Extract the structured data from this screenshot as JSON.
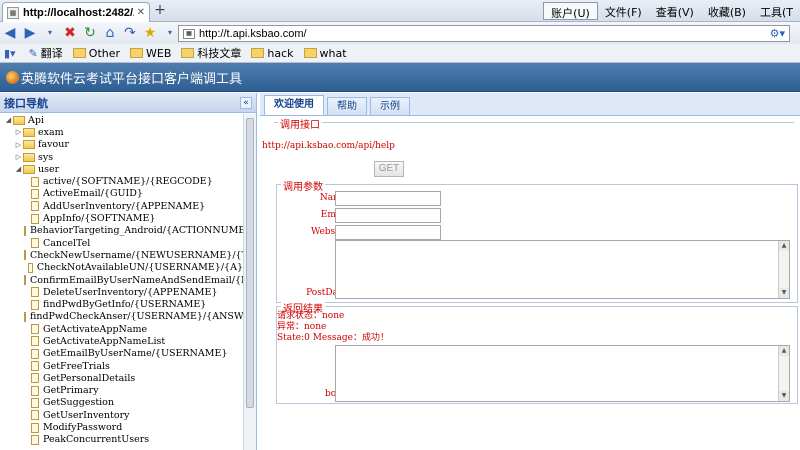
{
  "browser": {
    "tab_title": "http://localhost:2482/A...",
    "menus": [
      "账户(U)",
      "文件(F)",
      "查看(V)",
      "收藏(B)",
      "工具(T"
    ],
    "url": "http://t.api.ksbao.com/",
    "bookmarks": [
      "翻译",
      "Other",
      "WEB",
      "科技文章",
      "hack",
      "what"
    ]
  },
  "app": {
    "title": "英腾软件云考试平台接口客户端调工具"
  },
  "sidebar": {
    "title": "接口导航",
    "tree": [
      {
        "label": "Api",
        "level": 0,
        "kind": "folder",
        "expanded": true
      },
      {
        "label": "exam",
        "level": 1,
        "kind": "folder",
        "expanded": false
      },
      {
        "label": "favour",
        "level": 1,
        "kind": "folder",
        "expanded": false
      },
      {
        "label": "sys",
        "level": 1,
        "kind": "folder",
        "expanded": false
      },
      {
        "label": "user",
        "level": 1,
        "kind": "folder",
        "expanded": true
      },
      {
        "label": "active/{SOFTNAME}/{REGCODE}",
        "level": 2,
        "kind": "doc"
      },
      {
        "label": "ActiveEmail/{GUID}",
        "level": 2,
        "kind": "doc"
      },
      {
        "label": "AddUserInventory/{APPENAME}",
        "level": 2,
        "kind": "doc"
      },
      {
        "label": "AppInfo/{SOFTNAME}",
        "level": 2,
        "kind": "doc"
      },
      {
        "label": "BehaviorTargeting_Android/{ACTIONNUMBER}",
        "level": 2,
        "kind": "doc"
      },
      {
        "label": "CancelTel",
        "level": 2,
        "kind": "doc"
      },
      {
        "label": "CheckNewUsername/{NEWUSERNAME}/{TYPE}",
        "level": 2,
        "kind": "doc"
      },
      {
        "label": "CheckNotAvailableUN/{USERNAME}/{A}",
        "level": 2,
        "kind": "doc"
      },
      {
        "label": "ConfirmEmailByUserNameAndSendEmail/{EMAIL}/{USE",
        "level": 2,
        "kind": "doc"
      },
      {
        "label": "DeleteUserInventory/{APPENAME}",
        "level": 2,
        "kind": "doc"
      },
      {
        "label": "findPwdByGetInfo/{USERNAME}",
        "level": 2,
        "kind": "doc"
      },
      {
        "label": "findPwdCheckAnser/{USERNAME}/{ANSWER}",
        "level": 2,
        "kind": "doc"
      },
      {
        "label": "GetActivateAppName",
        "level": 2,
        "kind": "doc"
      },
      {
        "label": "GetActivateAppNameList",
        "level": 2,
        "kind": "doc"
      },
      {
        "label": "GetEmailByUserName/{USERNAME}",
        "level": 2,
        "kind": "doc"
      },
      {
        "label": "GetFreeTrials",
        "level": 2,
        "kind": "doc"
      },
      {
        "label": "GetPersonalDetails",
        "level": 2,
        "kind": "doc"
      },
      {
        "label": "GetPrimary",
        "level": 2,
        "kind": "doc"
      },
      {
        "label": "GetSuggestion",
        "level": 2,
        "kind": "doc"
      },
      {
        "label": "GetUserInventory",
        "level": 2,
        "kind": "doc"
      },
      {
        "label": "ModifyPassword",
        "level": 2,
        "kind": "doc"
      },
      {
        "label": "PeakConcurrentUsers",
        "level": 2,
        "kind": "doc"
      }
    ]
  },
  "tabs": [
    "欢迎使用",
    "帮助",
    "示例"
  ],
  "invoke": {
    "legend": "调用接口",
    "url": "http://api.ksbao.com/api/help",
    "button": "GET"
  },
  "params": {
    "legend": "调用参数",
    "name_label": "Name",
    "email_label": "Email",
    "website_label": "Website",
    "postdata_label": "PostData"
  },
  "result": {
    "legend": "返回结果",
    "status": "请求状态：none",
    "error": "异常：none",
    "message": "State:0  Message：成功！",
    "body_label": "body"
  },
  "colors": {
    "header_bg": "#3a6aa0",
    "label_red": "#d00000",
    "panel_border": "#99bbe8"
  }
}
